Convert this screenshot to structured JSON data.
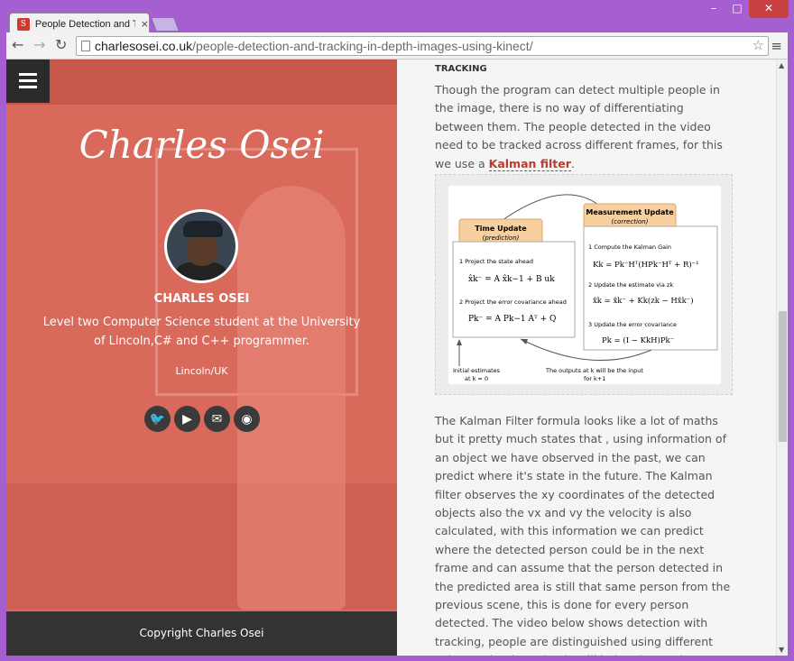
{
  "browser": {
    "tab_title": "People Detection and Trac",
    "tab_close": "×",
    "favicon_letter": "S",
    "url_host": "charlesosei.co.uk",
    "url_path": "/people-detection-and-tracking-in-depth-images-using-kinect/",
    "window_buttons": {
      "minimize": "–",
      "maximize": "□",
      "close": "✕"
    },
    "nav": {
      "back": "←",
      "forward": "→",
      "reload": "↻",
      "star": "☆",
      "menu": "≡"
    }
  },
  "sidebar": {
    "site_title": "Charles Osei",
    "author_name": "CHARLES OSEI",
    "bio": "Level two Computer Science student at the University of Lincoln,C# and C++ programmer.",
    "location": "Lincoln/UK",
    "social": [
      {
        "name": "twitter-icon",
        "glyph": "🐦"
      },
      {
        "name": "youtube-icon",
        "glyph": "▶"
      },
      {
        "name": "email-icon",
        "glyph": "✉"
      },
      {
        "name": "rss-icon",
        "glyph": "◉"
      }
    ],
    "footer": "Copyright Charles Osei"
  },
  "content": {
    "heading": "TRACKING",
    "para1_before": "Though the program can detect multiple people in the image, there is no way of differentiating between them. The people detected in the video need to be tracked across different frames, for this we use a",
    "para1_link": "Kalman filter",
    "para1_after": ".",
    "para2": "The Kalman Filter formula looks like a lot of maths but it pretty much states that , using information of an object we have observed in the past, we can predict where it's state in the future. The Kalman filter observes the xy coordinates of the detected objects also the vx and vy the velocity is also calculated, with this information we can predict where the detected person could be in the next frame and can assume that the person detected in the predicted area is still that same person from the previous scene, this is done for every person detected. The video below shows detection with tracking, people are distinguished using different colours. The detection is still being done using"
  },
  "diagram": {
    "time_update_title": "Time Update",
    "time_update_sub": "(prediction)",
    "measurement_title": "Measurement Update",
    "measurement_sub": "(correction)",
    "tu_step1": "1 Project the state ahead",
    "tu_eq1": "x̂k⁻ = A x̂k−1 + B uk",
    "tu_step2": "2 Project the error covariance ahead",
    "tu_eq2": "Pk⁻ = A Pk−1 Aᵀ + Q",
    "mu_step1": "1 Compute the Kalman Gain",
    "mu_eq1": "Kk = Pk⁻Hᵀ(HPk⁻Hᵀ + R)⁻¹",
    "mu_step2": "2 Update the estimate via zk",
    "mu_eq2": "x̂k = x̂k⁻ + Kk(zk − Hx̂k⁻)",
    "mu_step3": "3 Update the error covariance",
    "mu_eq3": "Pk = (I − KkH)Pk⁻",
    "initial_estimates": "Initial estimates",
    "initial_k": "at k = 0",
    "outputs_text": "The outputs at k  will be the input",
    "outputs_k": "for k+1"
  }
}
